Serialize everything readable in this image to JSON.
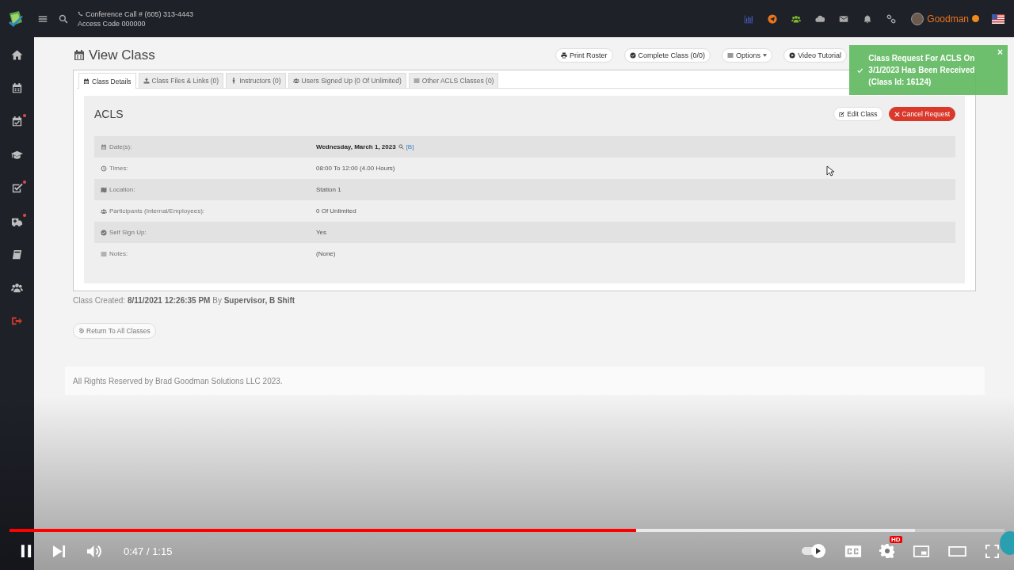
{
  "top_bar": {
    "conference_call": "Conference Call # (605) 313-4443",
    "access_code": "Access Code 000000",
    "icons": [
      {
        "kind": "chart"
      },
      {
        "kind": "send"
      },
      {
        "kind": "users"
      },
      {
        "kind": "cloud"
      },
      {
        "kind": "mail"
      },
      {
        "kind": "bell"
      },
      {
        "kind": "link"
      }
    ],
    "user_name": "Goodman",
    "online": true
  },
  "sidebar": {
    "items": [
      {
        "kind": "home",
        "alert": false
      },
      {
        "kind": "calendar",
        "alert": false
      },
      {
        "kind": "calendar-check",
        "alert": true
      },
      {
        "kind": "cap",
        "alert": false
      },
      {
        "kind": "check-square",
        "alert": true
      },
      {
        "kind": "ambulance",
        "alert": true
      },
      {
        "kind": "book",
        "alert": false
      },
      {
        "kind": "users",
        "alert": false
      },
      {
        "kind": "logout",
        "alert": false
      }
    ]
  },
  "page": {
    "title": "View Class",
    "actions": [
      {
        "kind": "print",
        "label": "Print Roster",
        "dropdown": false
      },
      {
        "kind": "check",
        "label": "Complete Class (0/0)",
        "dropdown": false
      },
      {
        "kind": "menu",
        "label": "Options",
        "dropdown": true
      },
      {
        "kind": "play",
        "label": "Video Tutorial",
        "dropdown": false
      }
    ]
  },
  "tabs": [
    {
      "kind": "calendar",
      "label": "Class Details",
      "selected": true
    },
    {
      "kind": "upload",
      "label": "Class Files & Links (0)",
      "selected": false
    },
    {
      "kind": "male",
      "label": "Instructors (0)",
      "selected": false
    },
    {
      "kind": "users",
      "label": "Users Signed Up (0 Of Unlimited)",
      "selected": false
    },
    {
      "kind": "menu",
      "label": "Other ACLS Classes (0)",
      "selected": false
    }
  ],
  "class": {
    "name": "ACLS",
    "buttons": [
      {
        "kind": "edit",
        "label": "Edit Class"
      },
      {
        "kind": "cancel",
        "label": "Cancel Request"
      }
    ],
    "details": [
      {
        "kind": "calendar",
        "label": "Date(s):",
        "value": "Wednesday, March 1, 2023",
        "strong": true,
        "link": "[B]"
      },
      {
        "kind": "clock",
        "label": "Times:",
        "value": "08:00 To 12:00 (4.00 Hours)",
        "strong": false
      },
      {
        "kind": "map",
        "label": "Location:",
        "value": "Station 1",
        "strong": false
      },
      {
        "kind": "users",
        "label": "Participants (Internal/Employees):",
        "value": "0 Of Unlimited",
        "strong": false
      },
      {
        "kind": "check",
        "label": "Self Sign Up:",
        "value": "Yes",
        "strong": false
      },
      {
        "kind": "menu",
        "label": "Notes:",
        "value": "(None)",
        "strong": false
      }
    ]
  },
  "created": "Class Created: **8/11/2021 12:26:35 PM** By **Supervisor, B Shift**",
  "return_button": "Return To All Classes",
  "footer": "All Rights Reserved by Brad Goodman Solutions LLC 2023.",
  "toast": {
    "message": "Class Request For ACLS On 3/1/2023 Has Been Received (Class Id: 16124)",
    "close": "×"
  },
  "player": {
    "progress": {
      "level": 0.63
    },
    "buffered": {
      "level": 0.91
    },
    "time": "0:47 / 1:15",
    "autoplay": true,
    "quality_badge": "HD"
  }
}
